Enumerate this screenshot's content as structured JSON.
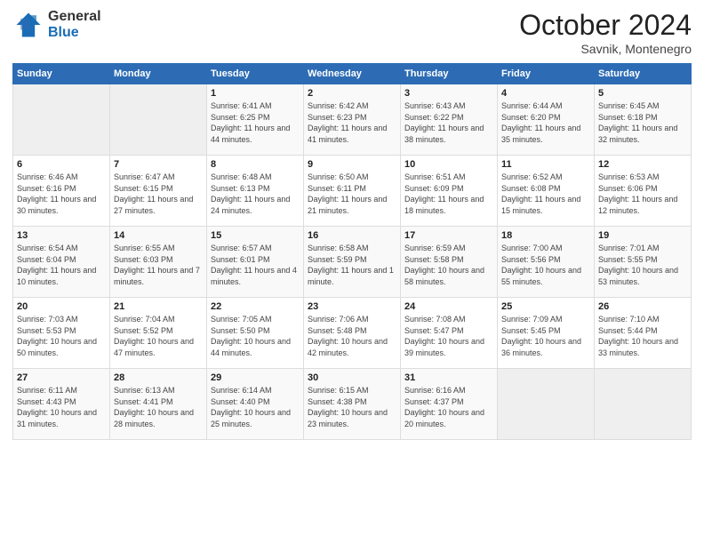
{
  "logo": {
    "general": "General",
    "blue": "Blue"
  },
  "header": {
    "month": "October 2024",
    "location": "Savnik, Montenegro"
  },
  "weekdays": [
    "Sunday",
    "Monday",
    "Tuesday",
    "Wednesday",
    "Thursday",
    "Friday",
    "Saturday"
  ],
  "weeks": [
    [
      {
        "day": "",
        "sunrise": "",
        "sunset": "",
        "daylight": ""
      },
      {
        "day": "",
        "sunrise": "",
        "sunset": "",
        "daylight": ""
      },
      {
        "day": "1",
        "sunrise": "Sunrise: 6:41 AM",
        "sunset": "Sunset: 6:25 PM",
        "daylight": "Daylight: 11 hours and 44 minutes."
      },
      {
        "day": "2",
        "sunrise": "Sunrise: 6:42 AM",
        "sunset": "Sunset: 6:23 PM",
        "daylight": "Daylight: 11 hours and 41 minutes."
      },
      {
        "day": "3",
        "sunrise": "Sunrise: 6:43 AM",
        "sunset": "Sunset: 6:22 PM",
        "daylight": "Daylight: 11 hours and 38 minutes."
      },
      {
        "day": "4",
        "sunrise": "Sunrise: 6:44 AM",
        "sunset": "Sunset: 6:20 PM",
        "daylight": "Daylight: 11 hours and 35 minutes."
      },
      {
        "day": "5",
        "sunrise": "Sunrise: 6:45 AM",
        "sunset": "Sunset: 6:18 PM",
        "daylight": "Daylight: 11 hours and 32 minutes."
      }
    ],
    [
      {
        "day": "6",
        "sunrise": "Sunrise: 6:46 AM",
        "sunset": "Sunset: 6:16 PM",
        "daylight": "Daylight: 11 hours and 30 minutes."
      },
      {
        "day": "7",
        "sunrise": "Sunrise: 6:47 AM",
        "sunset": "Sunset: 6:15 PM",
        "daylight": "Daylight: 11 hours and 27 minutes."
      },
      {
        "day": "8",
        "sunrise": "Sunrise: 6:48 AM",
        "sunset": "Sunset: 6:13 PM",
        "daylight": "Daylight: 11 hours and 24 minutes."
      },
      {
        "day": "9",
        "sunrise": "Sunrise: 6:50 AM",
        "sunset": "Sunset: 6:11 PM",
        "daylight": "Daylight: 11 hours and 21 minutes."
      },
      {
        "day": "10",
        "sunrise": "Sunrise: 6:51 AM",
        "sunset": "Sunset: 6:09 PM",
        "daylight": "Daylight: 11 hours and 18 minutes."
      },
      {
        "day": "11",
        "sunrise": "Sunrise: 6:52 AM",
        "sunset": "Sunset: 6:08 PM",
        "daylight": "Daylight: 11 hours and 15 minutes."
      },
      {
        "day": "12",
        "sunrise": "Sunrise: 6:53 AM",
        "sunset": "Sunset: 6:06 PM",
        "daylight": "Daylight: 11 hours and 12 minutes."
      }
    ],
    [
      {
        "day": "13",
        "sunrise": "Sunrise: 6:54 AM",
        "sunset": "Sunset: 6:04 PM",
        "daylight": "Daylight: 11 hours and 10 minutes."
      },
      {
        "day": "14",
        "sunrise": "Sunrise: 6:55 AM",
        "sunset": "Sunset: 6:03 PM",
        "daylight": "Daylight: 11 hours and 7 minutes."
      },
      {
        "day": "15",
        "sunrise": "Sunrise: 6:57 AM",
        "sunset": "Sunset: 6:01 PM",
        "daylight": "Daylight: 11 hours and 4 minutes."
      },
      {
        "day": "16",
        "sunrise": "Sunrise: 6:58 AM",
        "sunset": "Sunset: 5:59 PM",
        "daylight": "Daylight: 11 hours and 1 minute."
      },
      {
        "day": "17",
        "sunrise": "Sunrise: 6:59 AM",
        "sunset": "Sunset: 5:58 PM",
        "daylight": "Daylight: 10 hours and 58 minutes."
      },
      {
        "day": "18",
        "sunrise": "Sunrise: 7:00 AM",
        "sunset": "Sunset: 5:56 PM",
        "daylight": "Daylight: 10 hours and 55 minutes."
      },
      {
        "day": "19",
        "sunrise": "Sunrise: 7:01 AM",
        "sunset": "Sunset: 5:55 PM",
        "daylight": "Daylight: 10 hours and 53 minutes."
      }
    ],
    [
      {
        "day": "20",
        "sunrise": "Sunrise: 7:03 AM",
        "sunset": "Sunset: 5:53 PM",
        "daylight": "Daylight: 10 hours and 50 minutes."
      },
      {
        "day": "21",
        "sunrise": "Sunrise: 7:04 AM",
        "sunset": "Sunset: 5:52 PM",
        "daylight": "Daylight: 10 hours and 47 minutes."
      },
      {
        "day": "22",
        "sunrise": "Sunrise: 7:05 AM",
        "sunset": "Sunset: 5:50 PM",
        "daylight": "Daylight: 10 hours and 44 minutes."
      },
      {
        "day": "23",
        "sunrise": "Sunrise: 7:06 AM",
        "sunset": "Sunset: 5:48 PM",
        "daylight": "Daylight: 10 hours and 42 minutes."
      },
      {
        "day": "24",
        "sunrise": "Sunrise: 7:08 AM",
        "sunset": "Sunset: 5:47 PM",
        "daylight": "Daylight: 10 hours and 39 minutes."
      },
      {
        "day": "25",
        "sunrise": "Sunrise: 7:09 AM",
        "sunset": "Sunset: 5:45 PM",
        "daylight": "Daylight: 10 hours and 36 minutes."
      },
      {
        "day": "26",
        "sunrise": "Sunrise: 7:10 AM",
        "sunset": "Sunset: 5:44 PM",
        "daylight": "Daylight: 10 hours and 33 minutes."
      }
    ],
    [
      {
        "day": "27",
        "sunrise": "Sunrise: 6:11 AM",
        "sunset": "Sunset: 4:43 PM",
        "daylight": "Daylight: 10 hours and 31 minutes."
      },
      {
        "day": "28",
        "sunrise": "Sunrise: 6:13 AM",
        "sunset": "Sunset: 4:41 PM",
        "daylight": "Daylight: 10 hours and 28 minutes."
      },
      {
        "day": "29",
        "sunrise": "Sunrise: 6:14 AM",
        "sunset": "Sunset: 4:40 PM",
        "daylight": "Daylight: 10 hours and 25 minutes."
      },
      {
        "day": "30",
        "sunrise": "Sunrise: 6:15 AM",
        "sunset": "Sunset: 4:38 PM",
        "daylight": "Daylight: 10 hours and 23 minutes."
      },
      {
        "day": "31",
        "sunrise": "Sunrise: 6:16 AM",
        "sunset": "Sunset: 4:37 PM",
        "daylight": "Daylight: 10 hours and 20 minutes."
      },
      {
        "day": "",
        "sunrise": "",
        "sunset": "",
        "daylight": ""
      },
      {
        "day": "",
        "sunrise": "",
        "sunset": "",
        "daylight": ""
      }
    ]
  ]
}
